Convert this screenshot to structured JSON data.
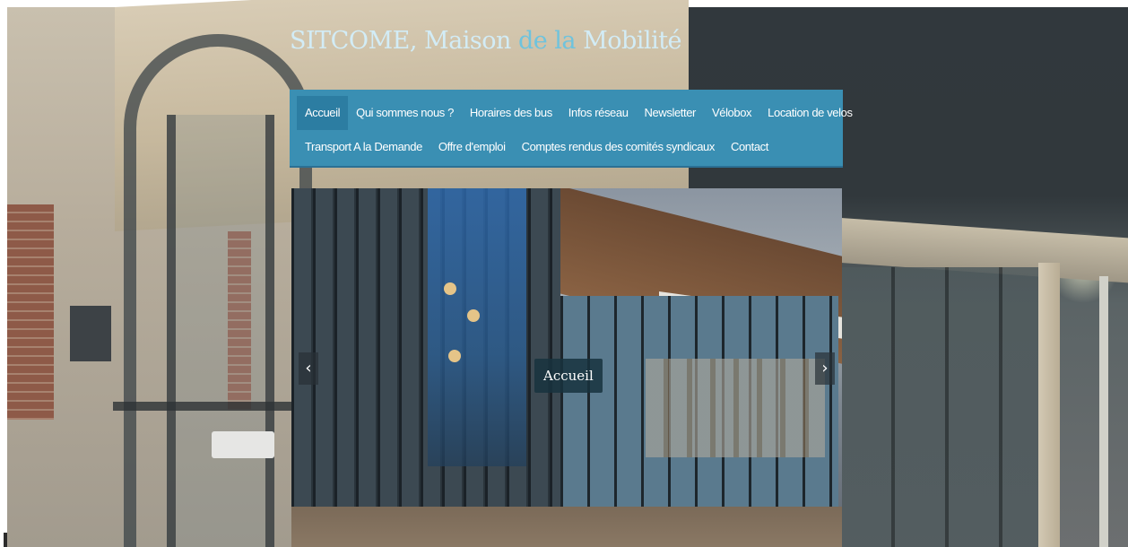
{
  "site": {
    "title_part1": "SITCOME, Maison ",
    "title_part2": "de la",
    "title_part3": " Mobilité"
  },
  "nav": {
    "row1": [
      "Accueil",
      "Qui sommes nous ?",
      "Horaires des bus",
      "Infos réseau",
      "Newsletter",
      "Vélobox",
      "Location de velos"
    ],
    "row2": [
      "Transport A la Demande",
      "Offre d'emploi",
      "Comptes rendus des comités syndicaux",
      "Contact"
    ],
    "active": "Accueil"
  },
  "slider": {
    "caption": "Accueil",
    "prev_icon": "chevron-left-icon",
    "next_icon": "chevron-right-icon",
    "prev_glyph": "‹",
    "next_glyph": "›"
  },
  "colors": {
    "nav_bg": "#3a8fb3",
    "nav_active": "#2c7da2",
    "title": "#d2ecf6",
    "title_accent": "#6fc3dd"
  }
}
